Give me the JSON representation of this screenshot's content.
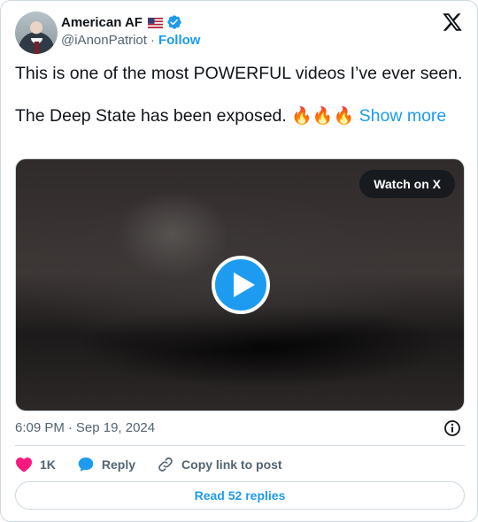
{
  "author": {
    "display_name": "American AF",
    "handle": "@iAnonPatriot",
    "separator": "·",
    "follow_label": "Follow",
    "flag_icon": "us-flag-icon",
    "verified_icon": "verified-badge-icon"
  },
  "tweet": {
    "line1": "This is one of the most POWERFUL videos I’ve ever seen.",
    "line2": "The Deep State has been exposed.",
    "emoji": "🔥🔥🔥",
    "show_more": "Show more"
  },
  "media": {
    "watch_label": "Watch on X",
    "play_icon": "play-icon"
  },
  "meta": {
    "time": "6:09 PM",
    "separator": "·",
    "date": "Sep 19, 2024"
  },
  "actions": {
    "like_count": "1K",
    "reply_label": "Reply",
    "copy_label": "Copy link to post"
  },
  "footer": {
    "read_replies": "Read 52 replies"
  },
  "colors": {
    "accent": "#1d9bf0",
    "like": "#f91880",
    "muted": "#536471",
    "text": "#0f1419",
    "border": "#cfd9de"
  }
}
